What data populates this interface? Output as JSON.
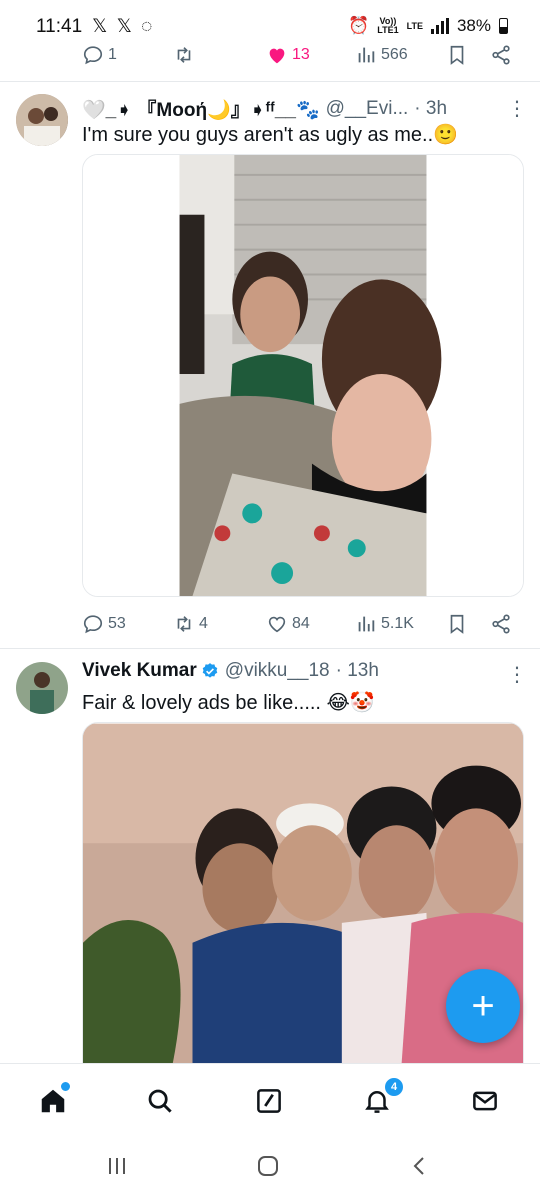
{
  "status_bar": {
    "time": "11:41",
    "notif_icons": "𝕏 𝕏 ◌",
    "volte": "Vo)) LTE1",
    "lte": "LTE",
    "battery": "38%"
  },
  "top_tweet_actions": {
    "replies": "1",
    "likes": "13",
    "views": "566"
  },
  "tweet1": {
    "display_name": "🤍_➧ 『Mooή🌙』➧ᶠᶠ__🐾",
    "handle": "@__Evi...",
    "time": "· 3h",
    "text": "I'm sure you guys aren't as ugly as me..🙂",
    "replies": "53",
    "retweets": "4",
    "likes": "84",
    "views": "5.1K"
  },
  "tweet2": {
    "display_name": "Vivek Kumar",
    "handle": "@vikku__18",
    "time": "· 13h",
    "text": "Fair & lovely ads be like..... 😂🤡"
  },
  "bottom_nav": {
    "notifications_badge": "4"
  },
  "colors": {
    "accent": "#1d9bf0",
    "like_pink": "#f91880",
    "muted": "#536471"
  }
}
